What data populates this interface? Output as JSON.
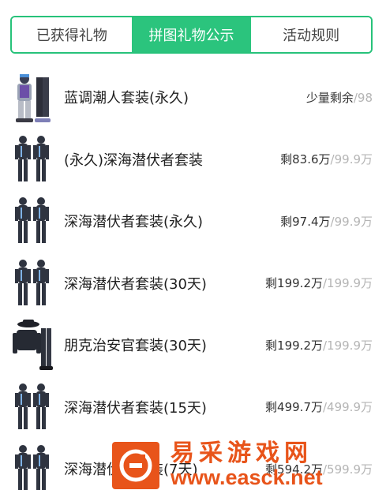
{
  "tabs": [
    {
      "label": "已获得礼物",
      "active": false
    },
    {
      "label": "拼图礼物公示",
      "active": true
    },
    {
      "label": "活动规则",
      "active": false
    }
  ],
  "gifts": [
    {
      "name": "蓝调潮人套装(永久)",
      "remaining": "少量剩余",
      "total": "/98",
      "icon": "blue-trendy-outfit-icon"
    },
    {
      "name": "(永久)深海潜伏者套装",
      "remaining": "剩83.6万",
      "total": "/99.9万",
      "icon": "deep-sea-diver-outfit-icon"
    },
    {
      "name": "深海潜伏者套装(永久)",
      "remaining": "剩97.4万",
      "total": "/99.9万",
      "icon": "deep-sea-diver-outfit-icon"
    },
    {
      "name": "深海潜伏者套装(30天)",
      "remaining": "剩199.2万",
      "total": "/199.9万",
      "icon": "deep-sea-diver-outfit-icon"
    },
    {
      "name": "朋克治安官套装(30天)",
      "remaining": "剩199.2万",
      "total": "/199.9万",
      "icon": "punk-sheriff-outfit-icon"
    },
    {
      "name": "深海潜伏者套装(15天)",
      "remaining": "剩499.7万",
      "total": "/499.9万",
      "icon": "deep-sea-diver-outfit-icon"
    },
    {
      "name": "深海潜伏者套装(7天)",
      "remaining": "剩594.2万",
      "total": "/599.9万",
      "icon": "deep-sea-diver-outfit-icon"
    }
  ],
  "watermark": {
    "cn": "易采游戏网",
    "url": "www.easck.net",
    "color": "#e8541a"
  },
  "colors": {
    "accent": "#2bc47d"
  }
}
